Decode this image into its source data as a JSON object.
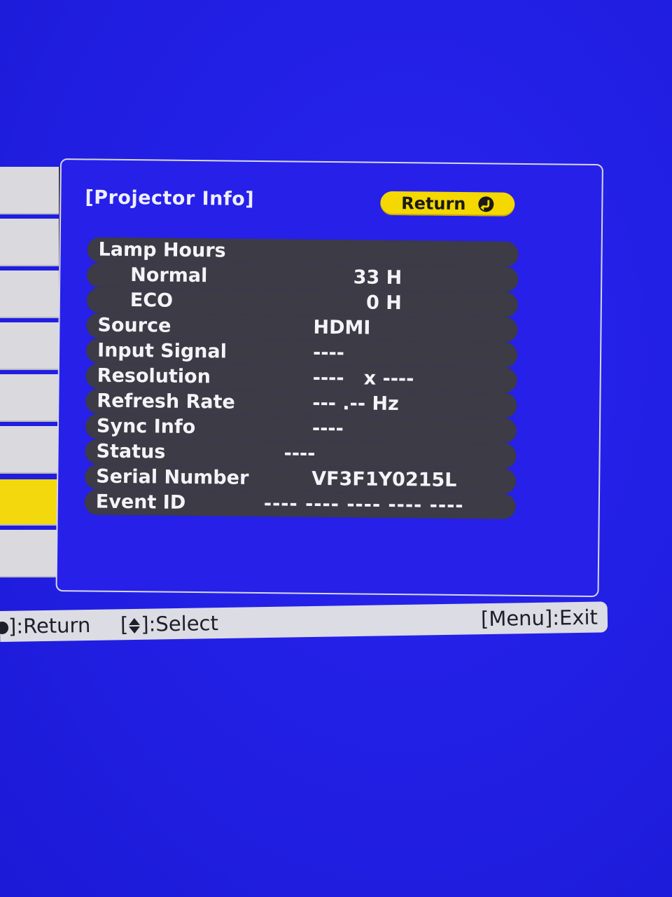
{
  "panel": {
    "title": "[Projector Info]",
    "return_label": "Return",
    "rows": [
      {
        "label": "Lamp Hours",
        "value": ""
      },
      {
        "label": "Normal",
        "value": "33 H"
      },
      {
        "label": "ECO",
        "value": "0 H"
      },
      {
        "label": "Source",
        "value": "HDMI"
      },
      {
        "label": "Input Signal",
        "value": "----"
      },
      {
        "label": "Resolution",
        "value": "----   x ----"
      },
      {
        "label": "Refresh Rate",
        "value": "--- .-- Hz"
      },
      {
        "label": "Sync Info",
        "value": "----"
      },
      {
        "label": "Status",
        "value": "----"
      },
      {
        "label": "Serial Number",
        "value": "VF3F1Y0215L"
      },
      {
        "label": "Event ID",
        "value": "---- ---- ---- ---- ----"
      }
    ]
  },
  "help_bar": {
    "return_hint": "]:Return",
    "select_hint_prefix": "[",
    "select_hint_suffix": "]:Select",
    "exit_hint": "[Menu]:Exit"
  },
  "colors": {
    "background": "#2320e6",
    "row_fill": "#3c3b46",
    "accent_yellow": "#f4d800",
    "menu_gray": "#d9d9de"
  },
  "icons": {
    "return_button_icon": "enter-return-icon",
    "select_icon": "up-down-arrow-icon"
  }
}
